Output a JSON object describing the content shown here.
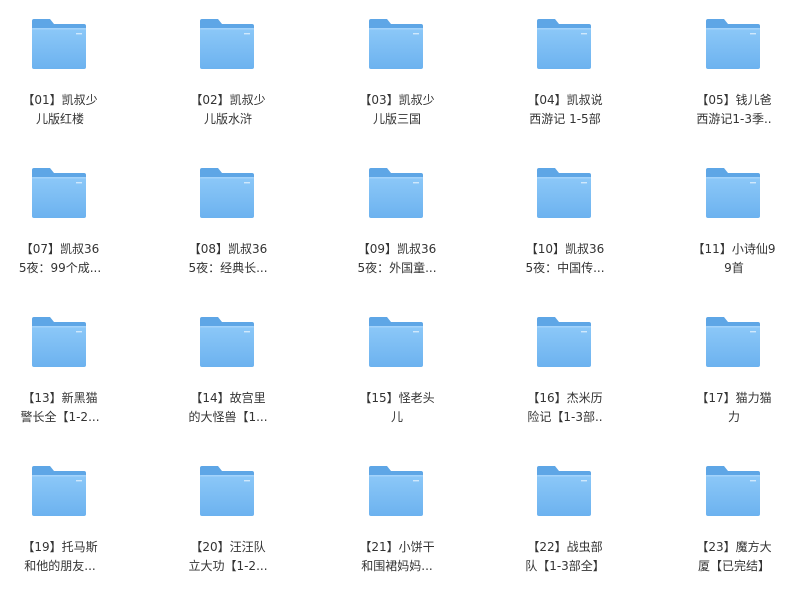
{
  "folders": [
    {
      "line1": "【01】凯叔少",
      "line2": "儿版红楼"
    },
    {
      "line1": "【02】凯叔少",
      "line2": "儿版水浒"
    },
    {
      "line1": "【03】凯叔少",
      "line2": "儿版三国"
    },
    {
      "line1": "【04】凯叔说",
      "line2": "西游记 1-5部"
    },
    {
      "line1": "【05】钱儿爸",
      "line2": "西游记1-3季.."
    },
    {
      "line1": "【07】凯叔36",
      "line2": "5夜：99个成..."
    },
    {
      "line1": "【08】凯叔36",
      "line2": "5夜：经典长..."
    },
    {
      "line1": "【09】凯叔36",
      "line2": "5夜：外国童..."
    },
    {
      "line1": "【10】凯叔36",
      "line2": "5夜：中国传..."
    },
    {
      "line1": "【11】小诗仙9",
      "line2": "9首"
    },
    {
      "line1": "【13】新黑猫",
      "line2": "警长全【1-2..."
    },
    {
      "line1": "【14】故宫里",
      "line2": "的大怪兽【1..."
    },
    {
      "line1": "【15】怪老头",
      "line2": "儿"
    },
    {
      "line1": "【16】杰米历",
      "line2": "险记【1-3部.."
    },
    {
      "line1": "【17】猫力猫",
      "line2": "力"
    },
    {
      "line1": "【19】托马斯",
      "line2": "和他的朋友..."
    },
    {
      "line1": "【20】汪汪队",
      "line2": "立大功【1-2..."
    },
    {
      "line1": "【21】小饼干",
      "line2": "和围裙妈妈..."
    },
    {
      "line1": "【22】战虫部",
      "line2": "队【1-3部全】"
    },
    {
      "line1": "【23】魔方大",
      "line2": "厦【已完结】"
    }
  ],
  "icon": "folder-icon",
  "colors": {
    "folder_back": "#5ea6e6",
    "folder_front_top": "#8cc8f8",
    "folder_front_bottom": "#6cb2ef",
    "label_text": "#333333"
  }
}
